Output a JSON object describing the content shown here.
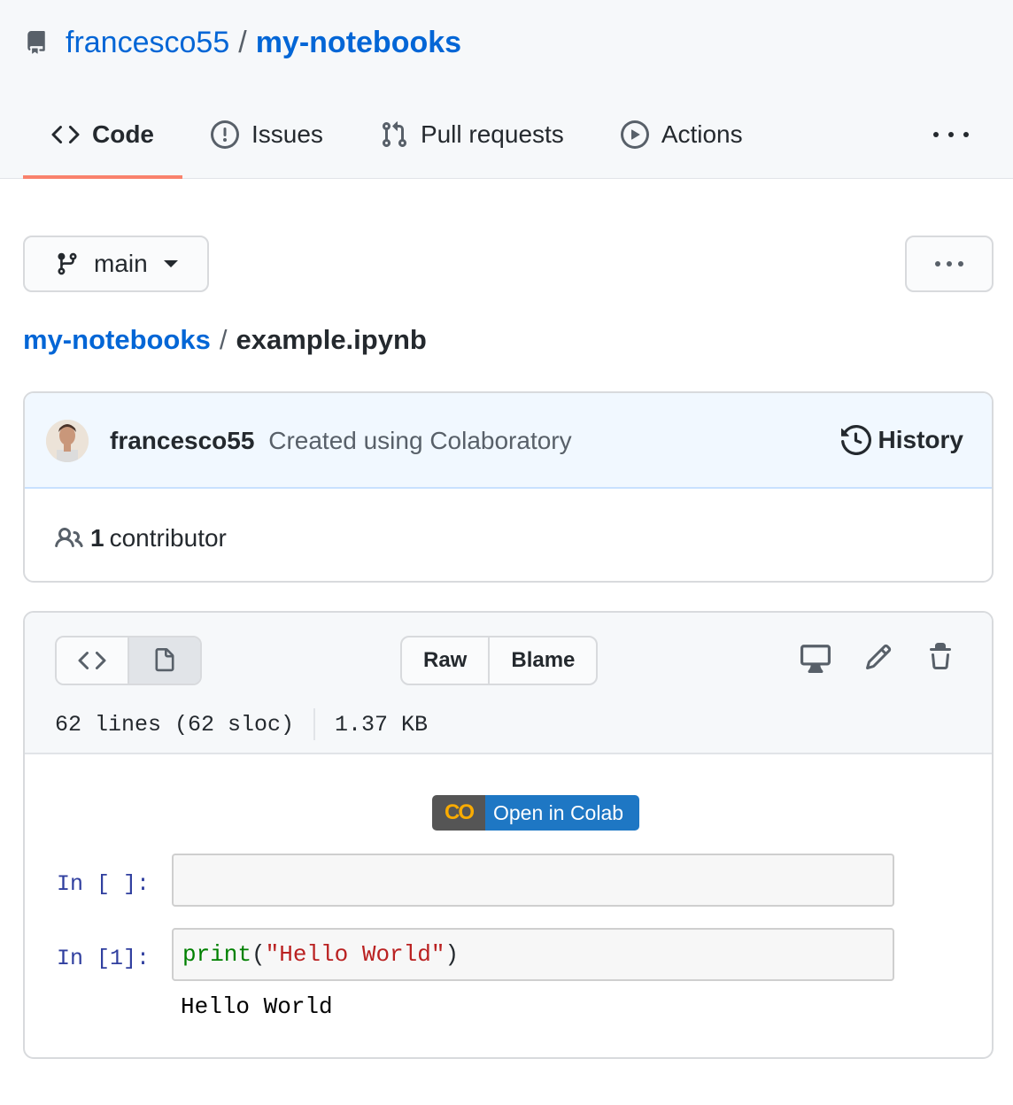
{
  "repo": {
    "owner": "francesco55",
    "separator": "/",
    "name": "my-notebooks"
  },
  "tabs": [
    {
      "label": "Code",
      "icon": "code-icon",
      "active": true
    },
    {
      "label": "Issues",
      "icon": "issue-icon",
      "active": false
    },
    {
      "label": "Pull requests",
      "icon": "pull-request-icon",
      "active": false
    },
    {
      "label": "Actions",
      "icon": "play-icon",
      "active": false
    }
  ],
  "branch": {
    "name": "main"
  },
  "breadcrumb": {
    "repo": "my-notebooks",
    "separator": "/",
    "file": "example.ipynb"
  },
  "commit": {
    "author": "francesco55",
    "message": "Created using Colaboratory",
    "history_label": "History"
  },
  "contributors": {
    "count": "1",
    "label": "contributor"
  },
  "file_actions": {
    "raw": "Raw",
    "blame": "Blame"
  },
  "file_meta": {
    "lines": "62 lines (62 sloc)",
    "size": "1.37 KB"
  },
  "colab_badge": {
    "logo": "CO",
    "label": "Open in Colab"
  },
  "cells": [
    {
      "prompt": "In [ ]:",
      "code_fn": "",
      "code_open": "",
      "code_str": "",
      "code_close": ""
    },
    {
      "prompt": "In [1]:",
      "code_fn": "print",
      "code_open": "(",
      "code_str": "\"Hello World\"",
      "code_close": ")",
      "output": "Hello World"
    }
  ],
  "colors": {
    "link": "#0366d6",
    "tab_underline": "#f9826c",
    "colab_blue": "#1e77c4",
    "prompt": "#303f9f"
  }
}
